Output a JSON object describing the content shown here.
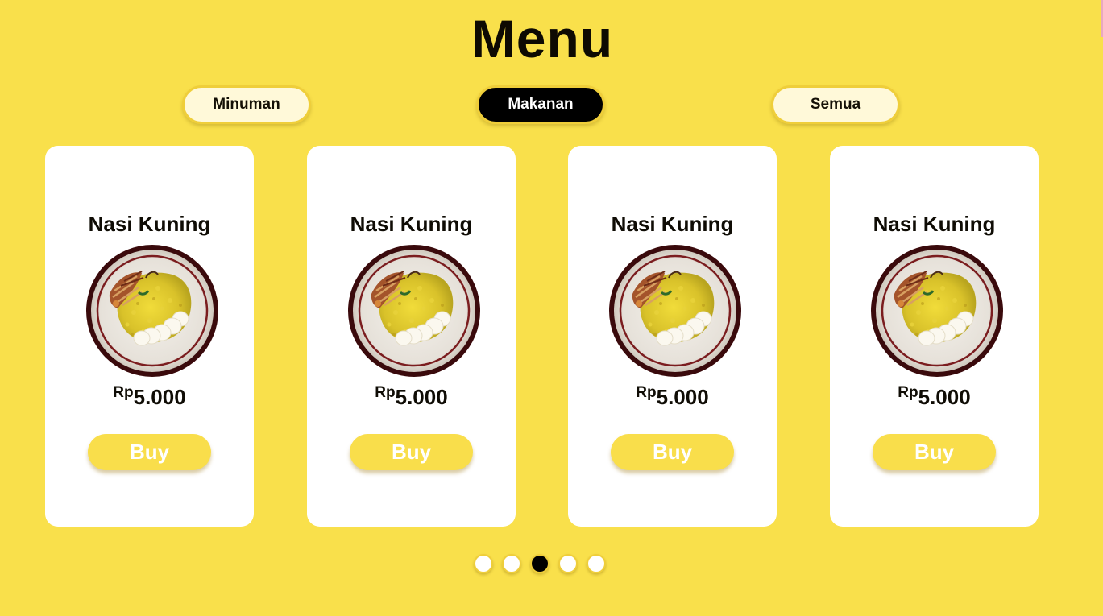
{
  "page": {
    "title": "Menu"
  },
  "tabs": [
    {
      "label": "Minuman",
      "active": false
    },
    {
      "label": "Makanan",
      "active": true
    },
    {
      "label": "Semua",
      "active": false
    }
  ],
  "cards": [
    {
      "name": "Nasi Kuning",
      "currency": "Rp",
      "price": "5.000",
      "button": "Buy",
      "image_icon": "nasi-kuning-plate"
    },
    {
      "name": "Nasi Kuning",
      "currency": "Rp",
      "price": "5.000",
      "button": "Buy",
      "image_icon": "nasi-kuning-plate"
    },
    {
      "name": "Nasi Kuning",
      "currency": "Rp",
      "price": "5.000",
      "button": "Buy",
      "image_icon": "nasi-kuning-plate"
    },
    {
      "name": "Nasi Kuning",
      "currency": "Rp",
      "price": "5.000",
      "button": "Buy",
      "image_icon": "nasi-kuning-plate"
    }
  ],
  "pagination": {
    "total_pages": 5,
    "active_page": 3
  },
  "colors": {
    "background": "#f9e04b",
    "card": "#ffffff",
    "active_tab": "#000000",
    "inactive_tab": "#fff9d9",
    "buy_button": "#f9de4b"
  }
}
